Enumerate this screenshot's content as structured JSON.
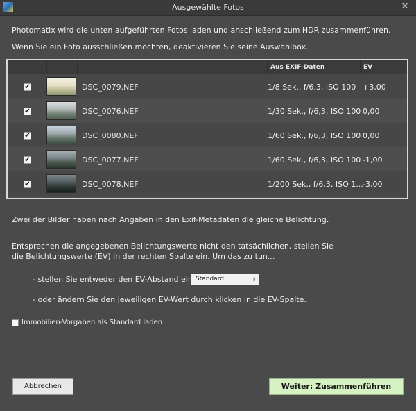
{
  "window": {
    "title": "Ausgewählte Fotos",
    "close_symbol": "✕"
  },
  "intro": {
    "line1": "Photomatix wird die unten aufgeführten Fotos laden und anschließend zum HDR zusammenführen.",
    "line2": "Wenn Sie ein Foto ausschließen möchten, deaktivieren Sie seine Auswahlbox."
  },
  "table": {
    "headers": {
      "exif": "Aus EXIF-Daten",
      "ev": "EV"
    },
    "rows": [
      {
        "checked": true,
        "checkmark": "✔",
        "filename": "DSC_0079.NEF",
        "exif": "1/8 Sek., f/6,3, ISO 100",
        "ev": "+3,00"
      },
      {
        "checked": true,
        "checkmark": "✔",
        "filename": "DSC_0076.NEF",
        "exif": "1/30 Sek., f/6,3, ISO 100",
        "ev": "0,00"
      },
      {
        "checked": true,
        "checkmark": "✔",
        "filename": "DSC_0080.NEF",
        "exif": "1/60 Sek., f/6,3, ISO 100",
        "ev": "0,00"
      },
      {
        "checked": true,
        "checkmark": "✔",
        "filename": "DSC_0077.NEF",
        "exif": "1/60 Sek., f/6,3, ISO 100",
        "ev": "-1,00"
      },
      {
        "checked": true,
        "checkmark": "✔",
        "filename": "DSC_0078.NEF",
        "exif": "1/200 Sek., f/6,3, ISO 1...",
        "ev": "-3,00"
      }
    ]
  },
  "notes": {
    "same_exposure": "Zwei der Bilder haben nach Angaben in den Exif-Metadaten die gleiche Belichtung.",
    "instr1": "Entsprechen die angegebenen Belichtungswerte nicht den tatsächlichen, stellen Sie",
    "instr2": "die Belichtungswerte (EV) in der rechten Spalte ein. Um das zu tun...",
    "option1": "- stellen Sie entweder den EV-Abstand ein",
    "option2": "- oder ändern Sie den jeweiligen EV-Wert durch klicken in die EV-Spalte."
  },
  "ev_spacing": {
    "selected": "Standard",
    "arrow": "⬍"
  },
  "real_estate": {
    "label": "Immobilien-Vorgaben als Standard laden",
    "checked": false
  },
  "buttons": {
    "cancel": "Abbrechen",
    "next": "Weiter: Zusammenführen"
  },
  "colors": {
    "background": "#4a4a4a",
    "next_button": "#d6f2c2",
    "frame": "#d8d8d8"
  }
}
